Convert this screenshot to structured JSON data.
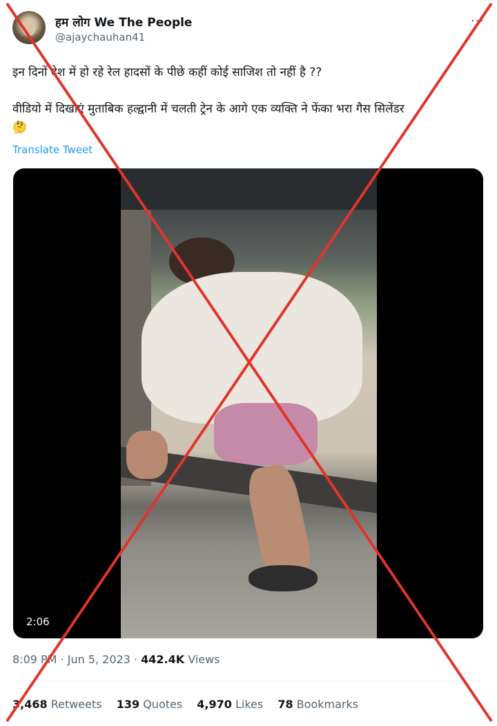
{
  "author": {
    "display_name": "हम लोग We The People",
    "handle": "@ajaychauhan41"
  },
  "more_label": "···",
  "tweet": {
    "line1": "इन दिनों देश में हो रहे रेल हादसों के पीछे कहीं कोई साजिश तो नहीं है ??",
    "line2": "वीडियो में दिखाएं मुताबिक हल्द्वानी में चलती ट्रेन के आगे एक व्यक्ति ने फेंका भरा गैस सिलेंडर",
    "emoji": "🤔",
    "translate_label": "Translate Tweet"
  },
  "video": {
    "duration": "2:06"
  },
  "meta": {
    "time": "8:09 PM",
    "sep1": " · ",
    "date": "Jun 5, 2023",
    "sep2": " · ",
    "views_count": "442.4K",
    "views_label": "Views"
  },
  "stats": {
    "retweets_count": "3,468",
    "retweets_label": "Retweets",
    "quotes_count": "139",
    "quotes_label": "Quotes",
    "likes_count": "4,970",
    "likes_label": "Likes",
    "bookmarks_count": "78",
    "bookmarks_label": "Bookmarks"
  },
  "colors": {
    "accent": "#1d9bf0",
    "secondary_text": "#536471",
    "cross_mark": "#e0352b"
  },
  "icons": {
    "overlay": "red-cross-false-mark"
  }
}
